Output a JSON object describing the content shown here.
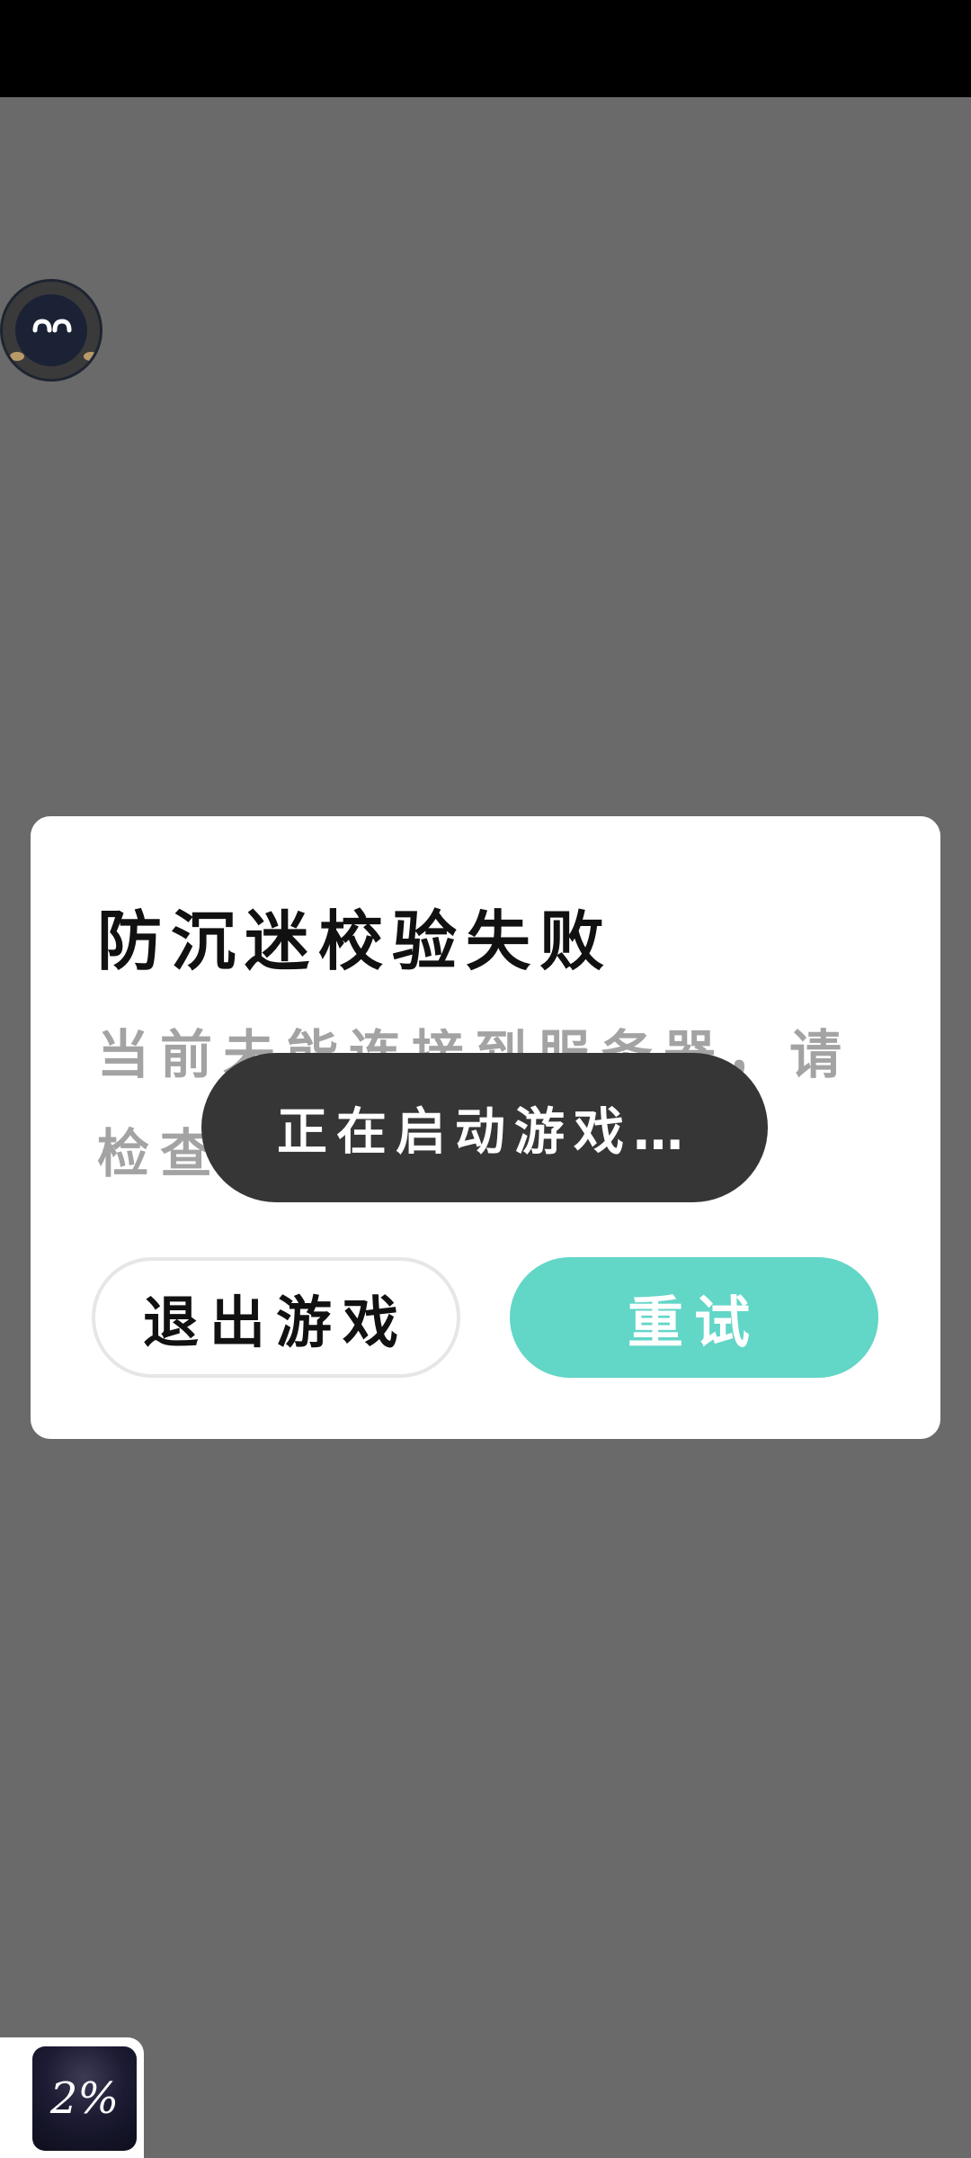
{
  "dialog": {
    "title": "防沉迷校验失败",
    "message": "当前未能连接到服务器，请检查网络",
    "exit_label": "退出游戏",
    "retry_label": "重试"
  },
  "toast": {
    "text": "正在启动游戏…"
  },
  "loader": {
    "progress_text": "2%"
  },
  "colors": {
    "overlay": "#6a6a6a",
    "accent": "#62d6c7",
    "toast_bg": "#363636"
  }
}
